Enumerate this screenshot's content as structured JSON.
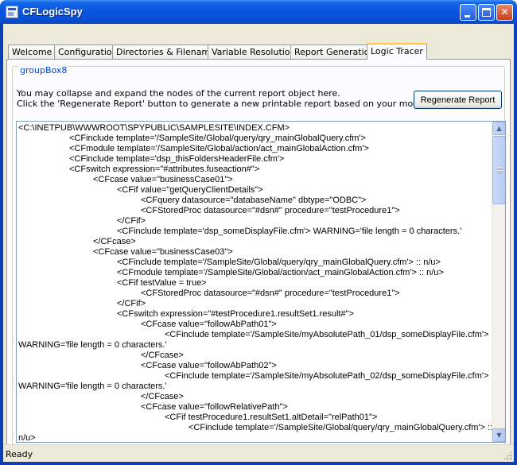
{
  "window": {
    "title": "CFLogicSpy"
  },
  "tabs": [
    {
      "label": "Welcome"
    },
    {
      "label": "Configuration"
    },
    {
      "label": "Directories & Filenames"
    },
    {
      "label": "Variable Resolution"
    },
    {
      "label": "Report Generation"
    },
    {
      "label": "Logic Tracer",
      "active": true
    }
  ],
  "group": {
    "title": "groupBox8",
    "desc_line1": "You may collapse and expand the nodes of the current report object here.",
    "desc_line2": "Click the 'Regenerate Report' button to generate a new printable report based on your modified trace below.",
    "regenerate_label": "Regenerate Report"
  },
  "tree": {
    "lines": [
      {
        "indent": 0,
        "text": "<C:\\INETPUB\\WWWROOT\\SPYPUBLIC\\SAMPLESITE\\INDEX.CFM>"
      },
      {
        "indent": 1,
        "text": "<CFinclude template='/SampleSite/Global/query/qry_mainGlobalQuery.cfm'>"
      },
      {
        "indent": 1,
        "text": "<CFmodule template='/SampleSite/Global/action/act_mainGlobalAction.cfm'>"
      },
      {
        "indent": 1,
        "text": "<CFinclude template='dsp_thisFoldersHeaderFile.cfm'>"
      },
      {
        "indent": 1,
        "text": "<CFswitch expression=\"#attributes.fuseaction#\">"
      },
      {
        "indent": 2,
        "text": "<CFcase value=\"businessCase01\">"
      },
      {
        "indent": 3,
        "text": "<CFif value=\"getQueryClientDetails\">"
      },
      {
        "indent": 4,
        "text": "<CFquery datasource=\"databaseName\" dbtype=\"ODBC\">"
      },
      {
        "indent": 4,
        "text": "<CFStoredProc datasource=\"#dsn#\" procedure=\"testProcedure1\">"
      },
      {
        "indent": 3,
        "text": "</CFif>"
      },
      {
        "indent": 3,
        "text": "<CFinclude template='dsp_someDisplayFile.cfm'> WARNING='file length = 0 characters.'"
      },
      {
        "indent": 2,
        "text": "</CFcase>"
      },
      {
        "indent": 2,
        "text": "<CFcase value=\"businessCase03\">"
      },
      {
        "indent": 3,
        "text": "<CFinclude template='/SampleSite/Global/query/qry_mainGlobalQuery.cfm'> :: n/u>"
      },
      {
        "indent": 3,
        "text": "<CFmodule template='/SampleSite/Global/action/act_mainGlobalAction.cfm'> :: n/u>"
      },
      {
        "indent": 3,
        "text": "<CFif testValue = true>"
      },
      {
        "indent": 4,
        "text": "<CFStoredProc datasource=\"#dsn#\" procedure=\"testProcedure1\">"
      },
      {
        "indent": 3,
        "text": "</CFif>"
      },
      {
        "indent": 3,
        "text": "<CFswitch expression=\"#testProcedure1.resultSet1.result#\">"
      },
      {
        "indent": 4,
        "text": "<CFcase value=\"followAbPath01\">"
      },
      {
        "indent": 5,
        "text": "<CFinclude template='/SampleSite/myAbsolutePath_01/dsp_someDisplayFile.cfm'>"
      },
      {
        "indent": 0,
        "text": "WARNING='file length = 0 characters.'"
      },
      {
        "indent": 4,
        "text": "</CFcase>"
      },
      {
        "indent": 4,
        "text": "<CFcase value=\"followAbPath02\">"
      },
      {
        "indent": 5,
        "text": "<CFinclude template='/SampleSite/myAbsolutePath_02/dsp_someDisplayFile.cfm'>"
      },
      {
        "indent": 0,
        "text": "WARNING='file length = 0 characters.'"
      },
      {
        "indent": 4,
        "text": "</CFcase>"
      },
      {
        "indent": 4,
        "text": "<CFcase value=\"followRelativePath\">"
      },
      {
        "indent": 5,
        "text": "<CFif testProcedure1.resultSet1.altDetail=\"relPath01\">"
      },
      {
        "indent": 6,
        "text": "<CFinclude template='/SampleSite/Global/query/qry_mainGlobalQuery.cfm'> ::"
      },
      {
        "indent": 0,
        "text": "n/u>"
      }
    ]
  },
  "statusbar": {
    "text": "Ready"
  }
}
